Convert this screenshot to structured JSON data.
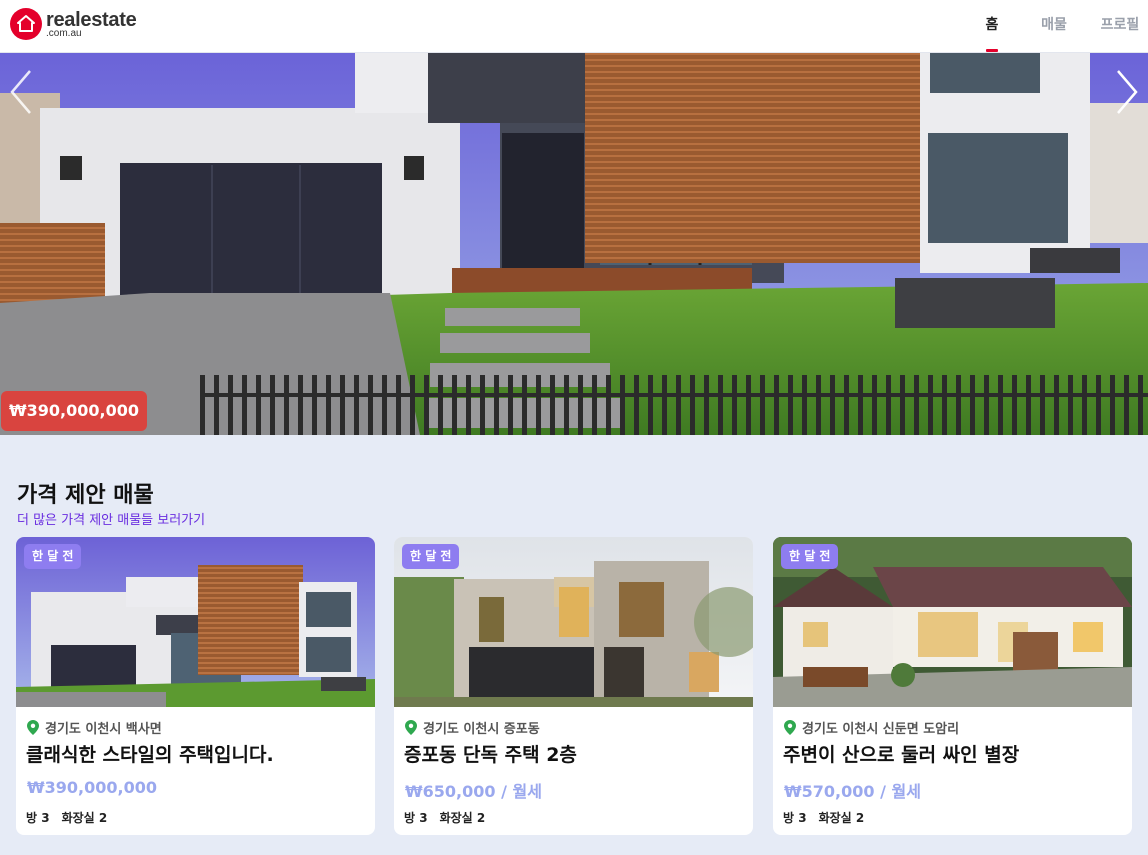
{
  "header": {
    "logo_main": "realestate",
    "logo_sub": ".com.au",
    "nav": [
      "홈",
      "매물",
      "프로필"
    ]
  },
  "hero": {
    "price": "₩390,000,000"
  },
  "section": {
    "title": "가격 제안 매물",
    "link": "더 많은 가격 제안 매물들 보러가기"
  },
  "cards": [
    {
      "badge": "한 달 전",
      "location": "경기도 이천시 백사면",
      "title": "클래식한 스타일의 주택입니다.",
      "price": "₩390,000,000",
      "rooms": "방 3",
      "baths": "화장실 2"
    },
    {
      "badge": "한 달 전",
      "location": "경기도 이천시 증포동",
      "title": "증포동 단독 주택 2층",
      "price": "₩650,000 / 월세",
      "rooms": "방 3",
      "baths": "화장실 2"
    },
    {
      "badge": "한 달 전",
      "location": "경기도 이천시 신둔면 도암리",
      "title": "주변이 산으로 둘러 싸인 별장",
      "price": "₩570,000 / 월세",
      "rooms": "방 3",
      "baths": "화장실 2"
    }
  ],
  "colors": {
    "brand": "#e4002b",
    "price_badge": "#d9443f",
    "card_badge": "#8e7df0",
    "link": "#6a2ee0",
    "price_text": "#9aa8ee",
    "pin": "#2fa84f",
    "background": "#e6ebf6"
  },
  "icons": [
    "home-logo-icon",
    "chevron-left-icon",
    "chevron-right-icon",
    "location-pin-icon"
  ]
}
